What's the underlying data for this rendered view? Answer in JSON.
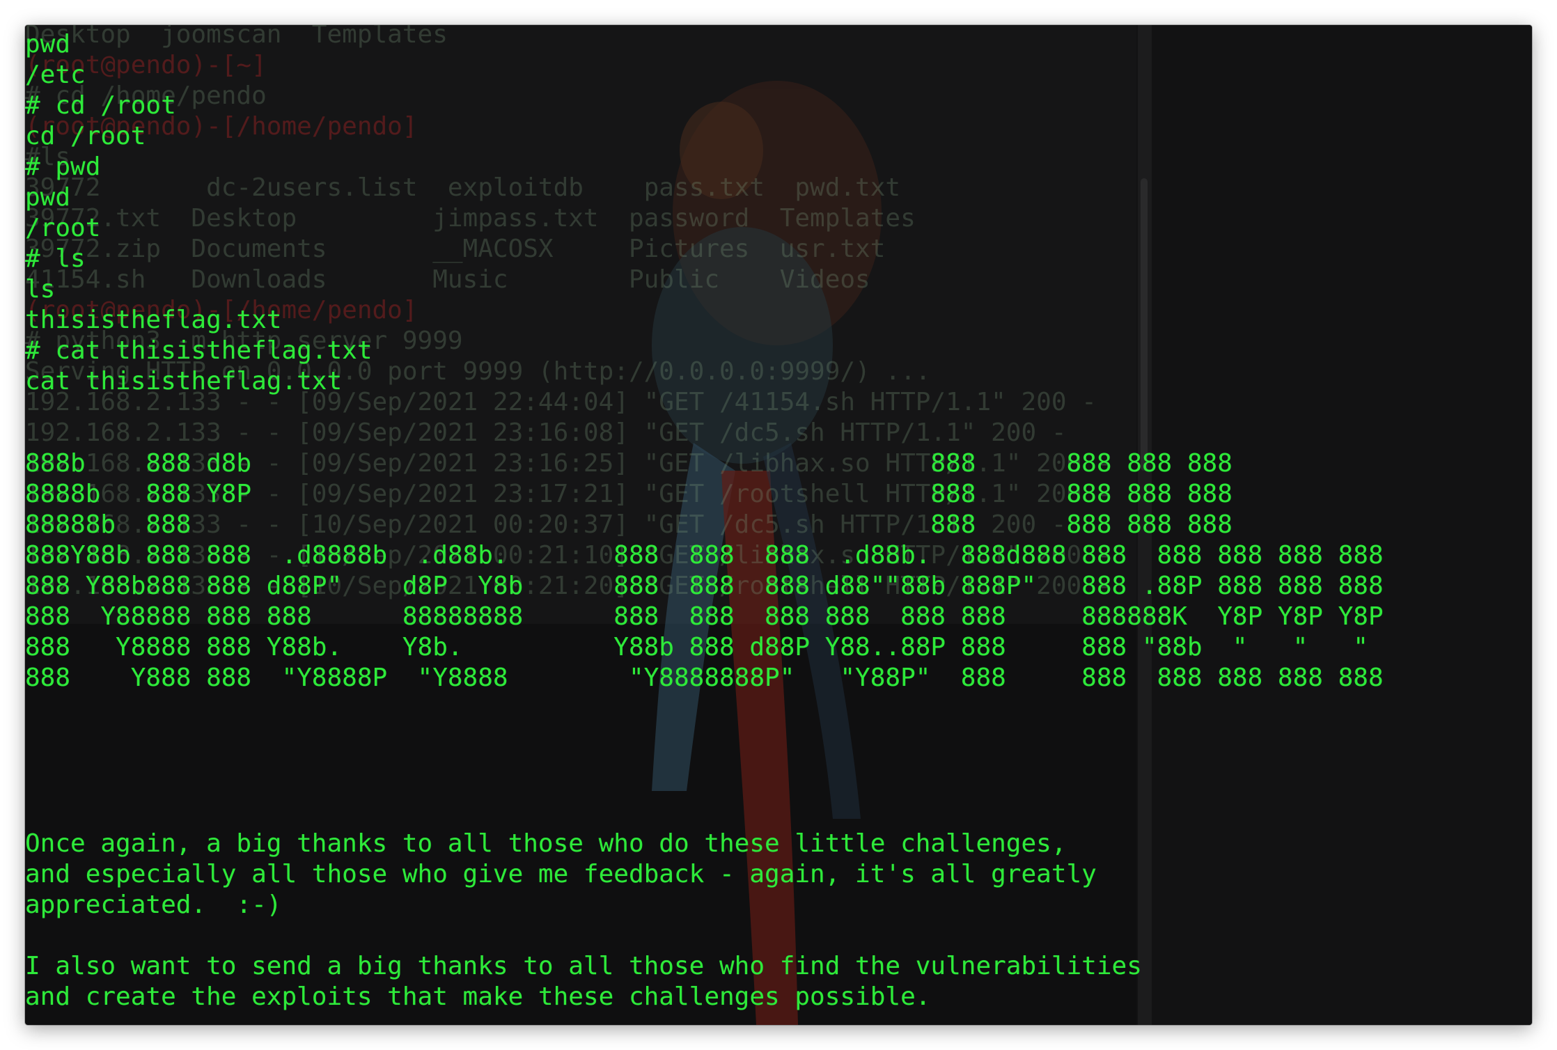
{
  "terminal": {
    "background_history": [
      "Desktop  joomscan  Templates",
      "(root@pendo)-[~]",
      "# cd /home/pendo",
      "(root@pendo)-[/home/pendo]",
      "#ls",
      "39772       dc-2users.list  exploitdb    pass.txt  pwd.txt",
      "39772.txt  Desktop         jimpass.txt  password  Templates",
      "39772.zip  Documents       __MACOSX     Pictures  usr.txt",
      "41154.sh   Downloads       Music        Public    Videos",
      "(root@pendo)-[/home/pendo]",
      "# python3 -m http.server 9999",
      "Serving HTTP on 0.0.0.0 port 9999 (http://0.0.0.0:9999/) ...",
      "192.168.2.133 - - [09/Sep/2021 22:44:04] \"GET /41154.sh HTTP/1.1\" 200 -",
      "192.168.2.133 - - [09/Sep/2021 23:16:08] \"GET /dc5.sh HTTP/1.1\" 200 -",
      "192.168.2.133 - - [09/Sep/2021 23:16:25] \"GET /libhax.so HTTP/1.1\" 200 -",
      "192.168.2.133 - - [09/Sep/2021 23:17:21] \"GET /rootshell HTTP/1.1\" 200 -",
      "192.168.2.133 - - [10/Sep/2021 00:20:37] \"GET /dc5.sh HTTP/1.1\" 200 -",
      "192.168.2.133 - - [10/Sep/2021 00:21:10] \"GET /libhax.so HTTP/1.1\" 200 -",
      "192.168.2.133 - - [10/Sep/2021 00:21:20] \"GET /rootshell HTTP/1.1\" 200 -"
    ],
    "session_lines": [
      "pwd",
      "/etc",
      "# cd /root",
      "cd /root",
      "# pwd",
      "pwd",
      "/root",
      "# ls",
      "ls",
      "thisistheflag.txt",
      "# cat thisistheflag.txt",
      "cat thisistheflag.txt"
    ],
    "ascii_banner": [
      "888b    888 d8b                                             888      888 888 888",
      "8888b   888 Y8P                                             888      888 888 888",
      "88888b  888                                                 888      888 888 888",
      "888Y88b 888 888  .d8888b  .d88b.       888  888  888  .d88b.  888d888 888  888 888 888 888",
      "888 Y88b888 888 d88P\"    d8P  Y8b      888  888  888 d88\"\"88b 888P\"   888 .88P 888 888 888",
      "888  Y88888 888 888      88888888      888  888  888 888  888 888     888888K  Y8P Y8P Y8P",
      "888   Y8888 888 Y88b.    Y8b.          Y88b 888 d88P Y88..88P 888     888 \"88b  \"   \"   \"",
      "888    Y888 888  \"Y8888P  \"Y8888        \"Y8888888P\"   \"Y88P\"  888     888  888 888 888 888"
    ],
    "message_lines": [
      "Once again, a big thanks to all those who do these little challenges,",
      "and especially all those who give me feedback - again, it's all greatly",
      "appreciated.  :-)",
      "",
      "I also want to send a big thanks to all those who find the vulnerabilities",
      "and create the exploits that make these challenges possible."
    ]
  }
}
